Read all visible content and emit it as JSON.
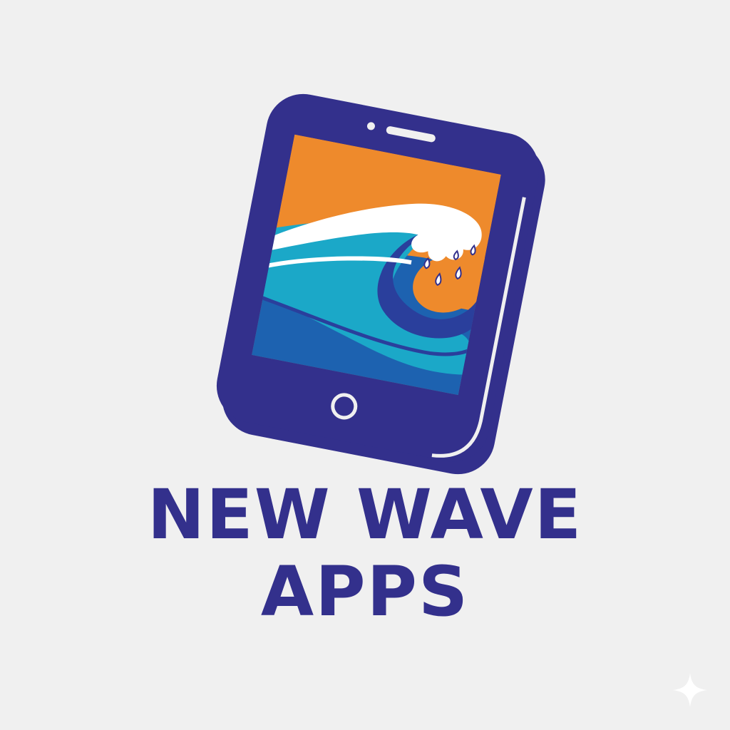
{
  "brand": {
    "name_line_1": "NEW WAVE",
    "name_line_2": "APPS"
  },
  "icons": {
    "logo": "phone-with-wave-icon",
    "corner": "sparkle-icon"
  },
  "colors": {
    "background": "#f0f0f0",
    "phone_body": "#33308c",
    "screen_sky": "#ee8a2c",
    "wave_teal": "#1ba8c8",
    "wave_blue": "#1d62b0",
    "wave_deep": "#2a3f9c",
    "foam": "#ffffff",
    "wordmark": "#33308c",
    "sparkle": "#ffffff"
  }
}
